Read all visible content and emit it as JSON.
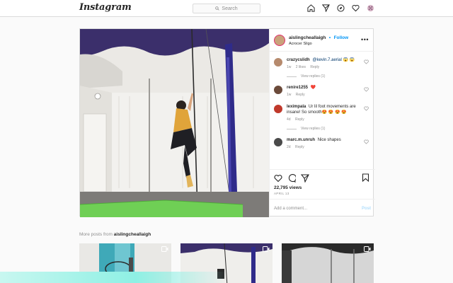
{
  "nav": {
    "logo": "Instagram",
    "search_placeholder": "Search",
    "icons": [
      "home-icon",
      "direct-icon",
      "explore-icon",
      "heart-icon",
      "profile-avatar"
    ]
  },
  "post": {
    "username": "aislingcheallaigh",
    "follow_label": "Follow",
    "separator": "•",
    "location": "Acrocer Sligo",
    "comments": [
      {
        "user": "crazycslidh",
        "mention": "@kevin.7.aerial",
        "text": "😱 😱",
        "time": "1w",
        "likes": "2 likes",
        "reply": "Reply",
        "view_replies": "View replies (1)"
      },
      {
        "user": "renire1255",
        "text": "❤️",
        "time": "1w",
        "reply": "Reply"
      },
      {
        "user": "leximpala",
        "text": "Ur lil foot movements are insane! So smooth😍 😍 😍 😍",
        "time": "4d",
        "reply": "Reply",
        "view_replies": "View replies (1)"
      },
      {
        "user": "marc.m.unruh",
        "text": "Nice shapes",
        "time": "2d",
        "reply": "Reply"
      }
    ],
    "views": "22,795 views",
    "date": "APRIL 13",
    "add_comment_placeholder": "Add a comment...",
    "post_button": "Post"
  },
  "more_posts": {
    "prefix": "More posts from",
    "username": "aislingcheallaigh"
  },
  "colors": {
    "accent_blue": "#0095f6",
    "border": "#dbdbdb",
    "heart_red": "#ed4956"
  }
}
